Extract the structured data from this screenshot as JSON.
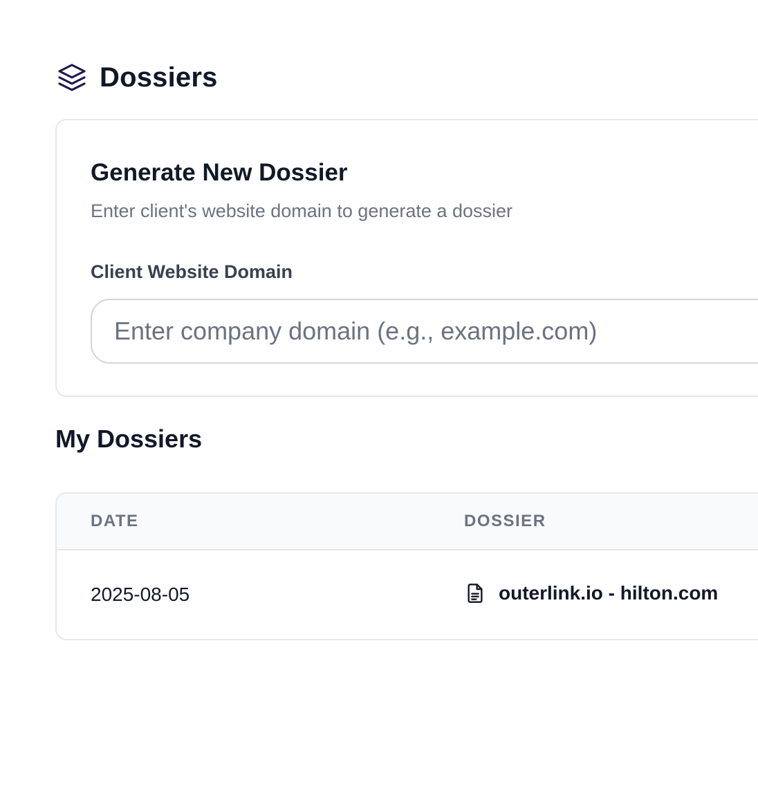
{
  "header": {
    "icon": "layers-icon",
    "title": "Dossiers"
  },
  "generate_card": {
    "title": "Generate New Dossier",
    "subtitle": "Enter client's website domain to generate a dossier",
    "domain_field": {
      "label": "Client Website Domain",
      "value": "",
      "placeholder": "Enter company domain (e.g., example.com)"
    }
  },
  "my_dossiers": {
    "title": "My Dossiers",
    "columns": [
      "DATE",
      "DOSSIER"
    ],
    "rows": [
      {
        "date": "2025-08-05",
        "dossier_icon": "document-icon",
        "dossier": "outerlink.io - hilton.com"
      }
    ]
  },
  "colors": {
    "text_primary": "#111827",
    "text_muted": "#6b7280",
    "border": "#e5e7eb",
    "header_bg": "#f9fafb"
  }
}
